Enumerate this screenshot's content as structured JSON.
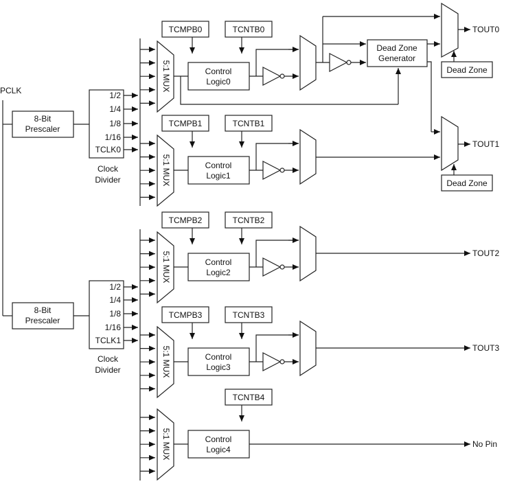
{
  "clock": {
    "input": "PCLK"
  },
  "prescalers": [
    {
      "line1": "8-Bit",
      "line2": "Prescaler"
    },
    {
      "line1": "8-Bit",
      "line2": "Prescaler"
    }
  ],
  "dividers": [
    {
      "ratios": [
        "1/2",
        "1/4",
        "1/8",
        "1/16",
        "TCLK0"
      ],
      "label1": "Clock",
      "label2": "Divider"
    },
    {
      "ratios": [
        "1/2",
        "1/4",
        "1/8",
        "1/16",
        "TCLK1"
      ],
      "label1": "Clock",
      "label2": "Divider"
    }
  ],
  "timers": [
    {
      "mux": "5:1 MUX",
      "tcmpb": "TCMPB0",
      "tcntb": "TCNTB0",
      "logic1": "Control",
      "logic2": "Logic0",
      "output": "TOUT0"
    },
    {
      "mux": "5:1 MUX",
      "tcmpb": "TCMPB1",
      "tcntb": "TCNTB1",
      "logic1": "Control",
      "logic2": "Logic1",
      "output": "TOUT1"
    },
    {
      "mux": "5:1 MUX",
      "tcmpb": "TCMPB2",
      "tcntb": "TCNTB2",
      "logic1": "Control",
      "logic2": "Logic2",
      "output": "TOUT2"
    },
    {
      "mux": "5:1 MUX",
      "tcmpb": "TCMPB3",
      "tcntb": "TCNTB3",
      "logic1": "Control",
      "logic2": "Logic3",
      "output": "TOUT3"
    },
    {
      "mux": "5:1 MUX",
      "tcntb": "TCNTB4",
      "logic1": "Control",
      "logic2": "Logic4",
      "output": "No Pin"
    }
  ],
  "dead_zone": {
    "generator_line1": "Dead Zone",
    "generator_line2": "Generator",
    "boxes": [
      "Dead Zone",
      "Dead Zone"
    ]
  }
}
